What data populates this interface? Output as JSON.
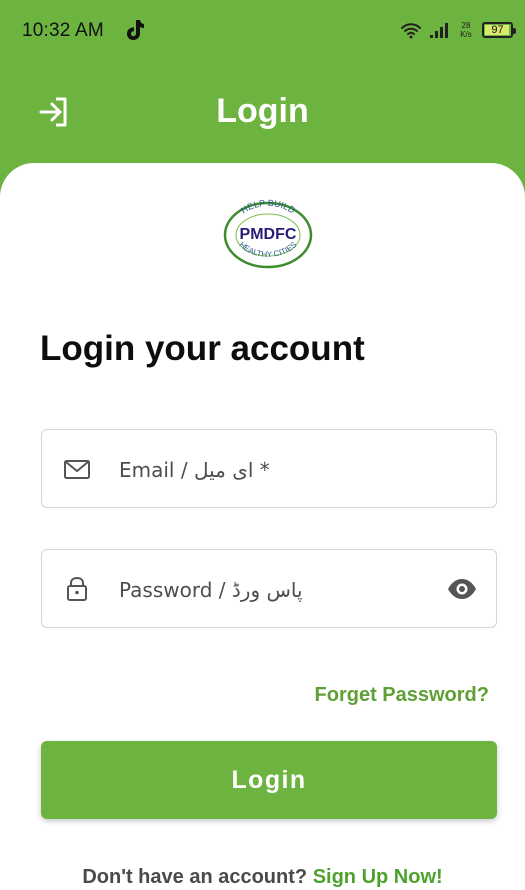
{
  "status_bar": {
    "time": "10:32 AM",
    "network_speed_value": "28",
    "network_speed_unit": "K/s",
    "battery_level": "97",
    "icons": [
      "tiktok-icon",
      "wifi-icon",
      "signal-icon",
      "battery-icon"
    ]
  },
  "header": {
    "title": "Login",
    "icon": "login-arrow-icon"
  },
  "logo": {
    "top_text": "HELP BUILD",
    "center_text": "PMDFC",
    "bottom_text": "HEALTHY CITIES"
  },
  "form": {
    "heading": "Login your account",
    "email_placeholder": "Email / ای میل *",
    "password_placeholder": "Password / پاس ورڈ",
    "email_icon": "mail-icon",
    "password_icon": "lock-icon",
    "visibility_icon": "eye-icon",
    "forgot_password": "Forget Password?",
    "login_button": "Login"
  },
  "footer": {
    "signup_prompt": "Don't have an account?",
    "signup_link": "Sign Up Now!"
  },
  "colors": {
    "primary_green": "#6db33f",
    "link_green": "#5f9f36",
    "text_dark": "#0d0d0d"
  }
}
